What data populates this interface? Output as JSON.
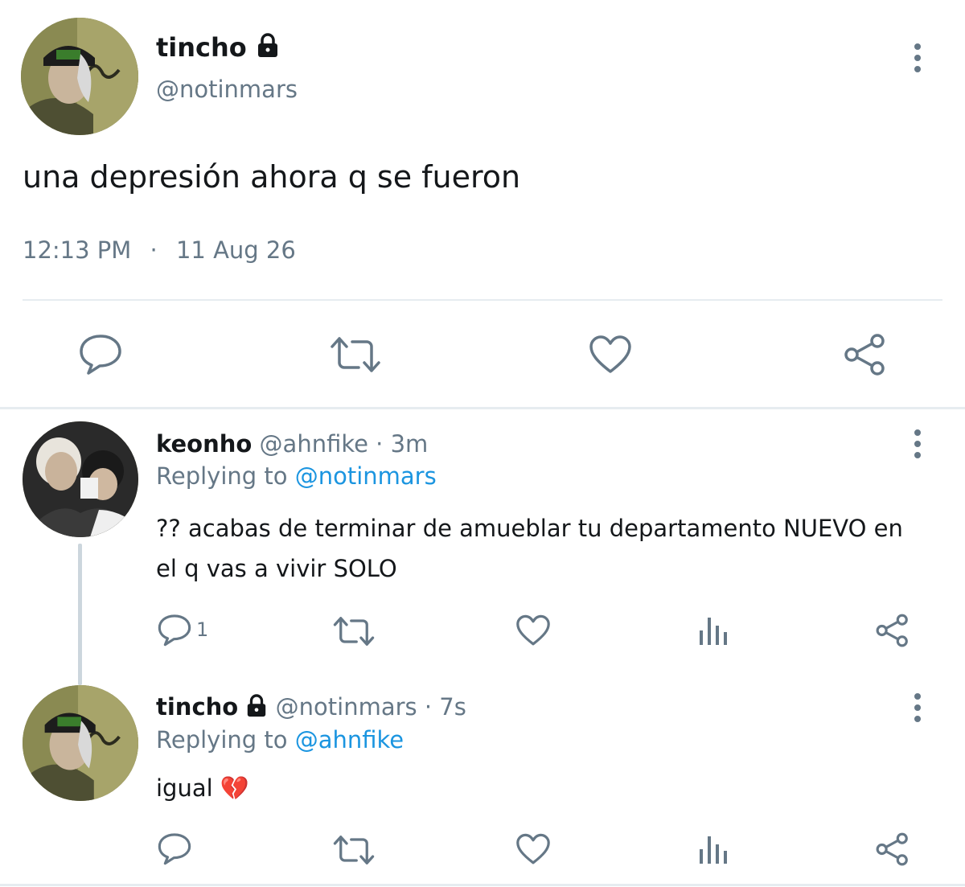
{
  "main_tweet": {
    "display_name": "tincho",
    "handle": "@notinmars",
    "text": "una depresión ahora q se fueron",
    "time": "12:13 PM",
    "separator": "·",
    "date": "11 Aug 26",
    "protected_icon": "lock-icon",
    "actions": [
      "reply-icon",
      "retweet-icon",
      "like-icon",
      "share-icon"
    ]
  },
  "replies": [
    {
      "display_name": "keonho",
      "handle": "@ahnfike",
      "time": "· 3m",
      "replying_prefix": "Replying to",
      "replying_to": "@notinmars",
      "text": "?? acabas de terminar de amueblar tu departamento NUEVO en el q vas a vivir SOLO",
      "reply_count": "1",
      "actions": [
        "reply-icon",
        "retweet-icon",
        "like-icon",
        "analytics-icon",
        "share-icon"
      ]
    },
    {
      "display_name": "tincho",
      "handle": "@notinmars",
      "time": "· 7s",
      "replying_prefix": "Replying to",
      "replying_to": "@ahnfike",
      "text": "igual 💔",
      "protected_icon": "lock-icon",
      "actions": [
        "reply-icon",
        "retweet-icon",
        "like-icon",
        "analytics-icon",
        "share-icon"
      ]
    }
  ],
  "colors": {
    "text": "#14171a",
    "muted": "#657786",
    "link": "#1b95e0",
    "divider": "#e6ecf0",
    "thread_line": "#ccd6dd"
  }
}
